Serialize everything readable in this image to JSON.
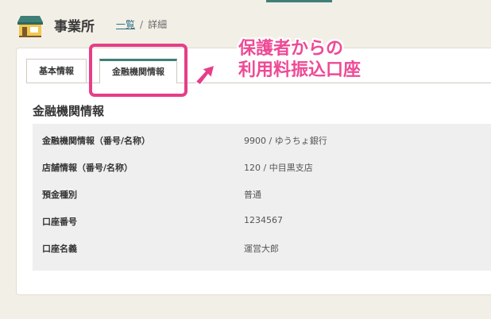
{
  "header": {
    "title": "事業所",
    "breadcrumb": {
      "link": "一覧",
      "separator": "/",
      "current": "詳細"
    }
  },
  "tabs": [
    {
      "label": "基本情報",
      "active": false
    },
    {
      "label": "金融機関情報",
      "active": true
    }
  ],
  "section": {
    "title": "金融機関情報"
  },
  "rows": [
    {
      "label": "金融機関情報（番号/名称）",
      "value": "9900 / ゆうちょ銀行"
    },
    {
      "label": "店舗情報（番号/名称）",
      "value": "120 / 中目黒支店"
    },
    {
      "label": "預金種別",
      "value": "普通"
    },
    {
      "label": "口座番号",
      "value": "1234567"
    },
    {
      "label": "口座名義",
      "value": "運営大郎"
    }
  ],
  "callout": {
    "line1": "保護者からの",
    "line2": "利用料振込口座"
  },
  "colors": {
    "accent": "#3f7f78",
    "annotation": "#e63e88",
    "link": "#2f6e82"
  }
}
